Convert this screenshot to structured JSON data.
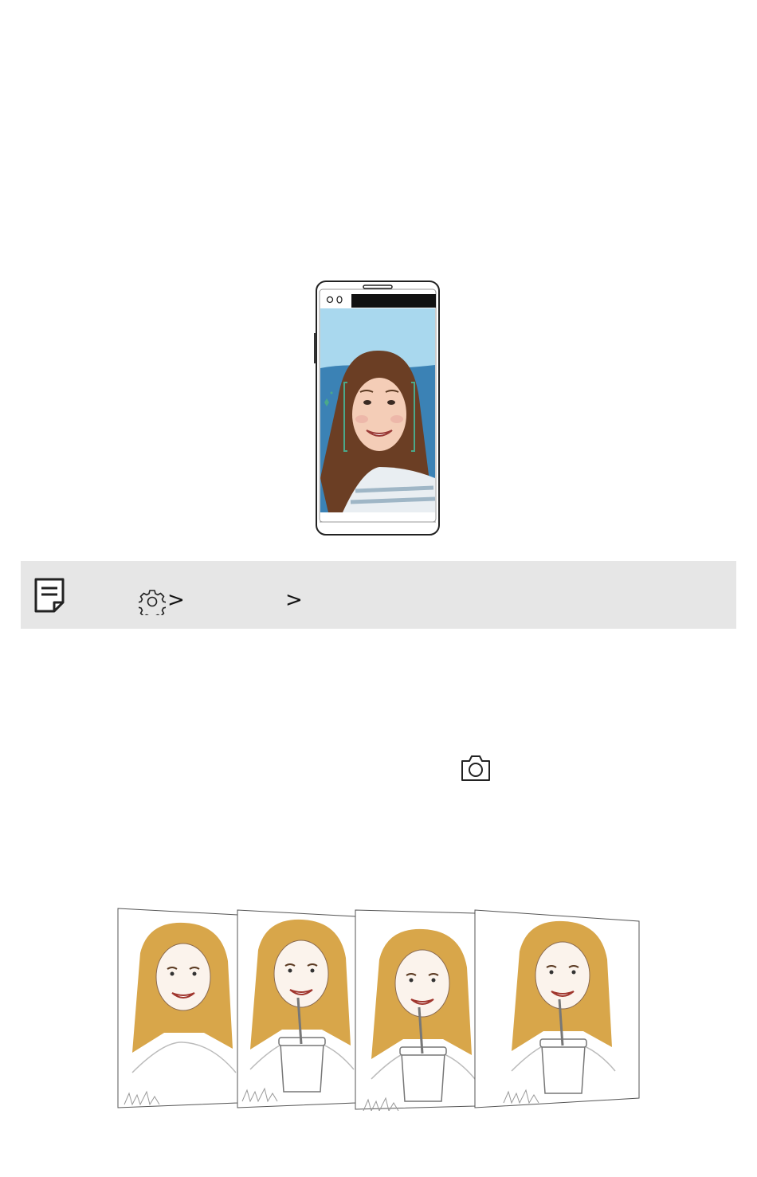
{
  "note": {
    "icons": [
      "note-icon",
      "settings-gear-icon",
      "camera-icon"
    ],
    "separators": [
      ">",
      ">"
    ]
  },
  "illustrations": {
    "phone": "phone-selfie-illustration",
    "strip": "burst-shot-photo-strip"
  },
  "colors": {
    "note_background": "#e6e6e6",
    "sky": "#a9d8ee",
    "face_frame": "#4aa98a",
    "hair": "#d8a64a"
  }
}
